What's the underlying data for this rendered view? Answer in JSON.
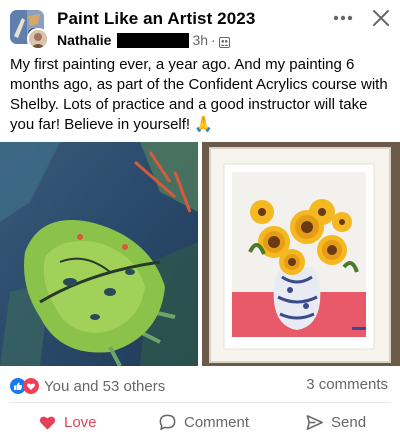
{
  "header": {
    "group_name": "Paint Like an Artist 2023",
    "author_name": "Nathalie",
    "time": "3h",
    "separator": "·",
    "audience_icon": "group-audience-icon",
    "more_icon": "more-options-icon",
    "close_icon": "close-icon"
  },
  "post": {
    "text": "My first painting ever, a year ago. And my painting 6 months ago, as part of the Confident Acrylics course with Shelby. Lots of practice and a good instructor will take you far! Believe in yourself! 🙏"
  },
  "images": [
    {
      "name": "monstera-leaf-painting"
    },
    {
      "name": "sunflowers-vase-painting"
    }
  ],
  "engagement": {
    "reactions_text": "You and 53 others",
    "comments_text": "3 comments",
    "reaction_icons": [
      "like-reaction-icon",
      "love-reaction-icon"
    ]
  },
  "actions": {
    "love_label": "Love",
    "comment_label": "Comment",
    "send_label": "Send"
  },
  "colors": {
    "love": "#e4415a",
    "like": "#1877f2",
    "secondary_text": "#65676b"
  }
}
